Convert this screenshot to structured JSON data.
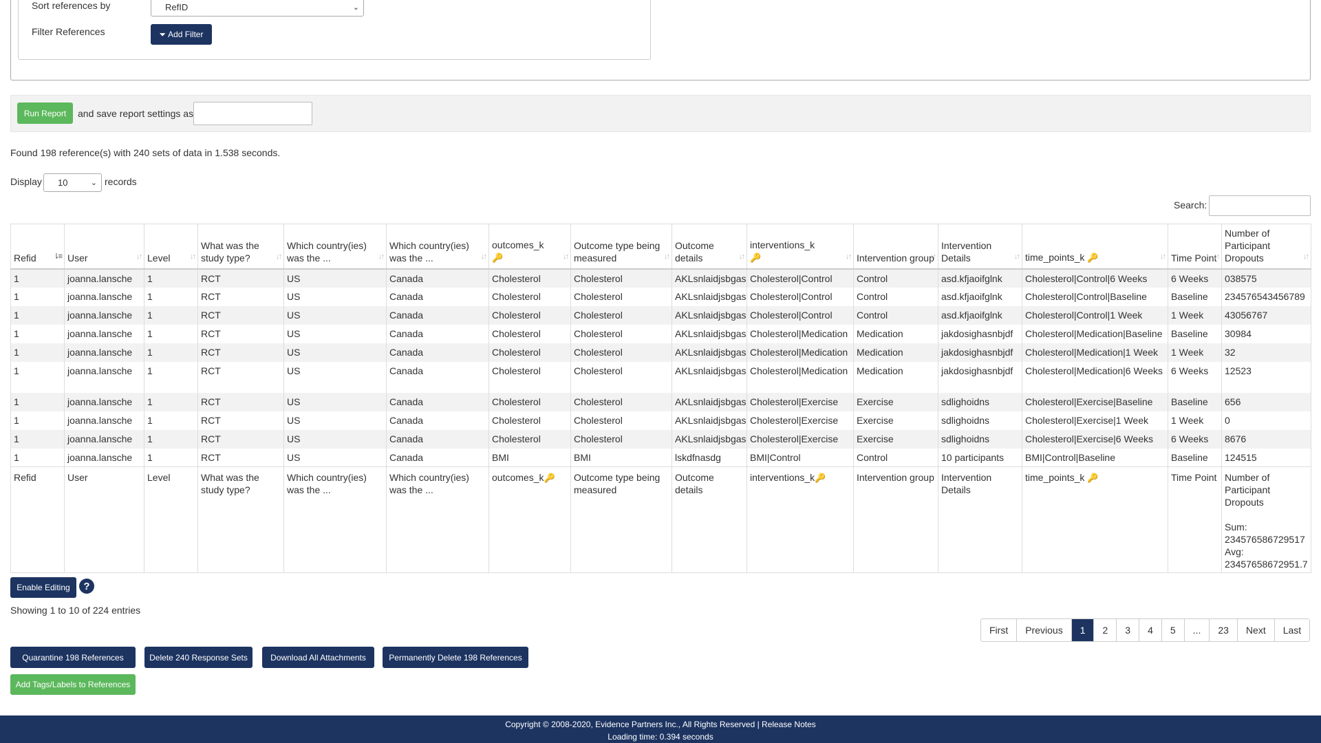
{
  "filters": {
    "sort_label": "Sort references by",
    "sort_value": "RefID",
    "filter_label": "Filter References",
    "add_filter_label": "Add Filter"
  },
  "report": {
    "run_label": "Run Report",
    "save_label": "and save report settings as",
    "save_value": ""
  },
  "summary": "Found 198 reference(s) with 240 sets of data in 1.538 seconds.",
  "display": {
    "label": "Display",
    "value": "10",
    "suffix": "records"
  },
  "search": {
    "label": "Search:",
    "value": ""
  },
  "table": {
    "headers": [
      "Refid",
      "User",
      "Level",
      "What was the study type?",
      "Which country(ies) was the ...",
      "Which country(ies) was the ...",
      "outcomes_k",
      "Outcome type being measured",
      "Outcome details",
      "interventions_k",
      "Intervention group",
      "Intervention Details",
      "time_points_k",
      "Time Point",
      "Number of Participant Dropouts"
    ],
    "rows": [
      [
        "1",
        "joanna.lansche",
        "1",
        "RCT",
        "US",
        "Canada",
        "Cholesterol",
        "Cholesterol",
        "AKLsnlaidjsbgas",
        "Cholesterol|Control",
        "Control",
        "asd.kfjaoifglnk",
        "Cholesterol|Control|6 Weeks",
        "6 Weeks",
        "038575"
      ],
      [
        "1",
        "joanna.lansche",
        "1",
        "RCT",
        "US",
        "Canada",
        "Cholesterol",
        "Cholesterol",
        "AKLsnlaidjsbgas",
        "Cholesterol|Control",
        "Control",
        "asd.kfjaoifglnk",
        "Cholesterol|Control|Baseline",
        "Baseline",
        "234576543456789"
      ],
      [
        "1",
        "joanna.lansche",
        "1",
        "RCT",
        "US",
        "Canada",
        "Cholesterol",
        "Cholesterol",
        "AKLsnlaidjsbgas",
        "Cholesterol|Control",
        "Control",
        "asd.kfjaoifglnk",
        "Cholesterol|Control|1 Week",
        "1 Week",
        "43056767"
      ],
      [
        "1",
        "joanna.lansche",
        "1",
        "RCT",
        "US",
        "Canada",
        "Cholesterol",
        "Cholesterol",
        "AKLsnlaidjsbgas",
        "Cholesterol|Medication",
        "Medication",
        "jakdosighasnbjdf",
        "Cholesterol|Medication|Baseline",
        "Baseline",
        "30984"
      ],
      [
        "1",
        "joanna.lansche",
        "1",
        "RCT",
        "US",
        "Canada",
        "Cholesterol",
        "Cholesterol",
        "AKLsnlaidjsbgas",
        "Cholesterol|Medication",
        "Medication",
        "jakdosighasnbjdf",
        "Cholesterol|Medication|1 Week",
        "1 Week",
        "32"
      ],
      [
        "1",
        "joanna.lansche",
        "1",
        "RCT",
        "US",
        "Canada",
        "Cholesterol",
        "Cholesterol",
        "AKLsnlaidjsbgas",
        "Cholesterol|Medication",
        "Medication",
        "jakdosighasnbjdf",
        "Cholesterol|Medication|6 Weeks",
        "6 Weeks",
        "12523"
      ],
      [
        "1",
        "joanna.lansche",
        "1",
        "RCT",
        "US",
        "Canada",
        "Cholesterol",
        "Cholesterol",
        "AKLsnlaidjsbgas",
        "Cholesterol|Exercise",
        "Exercise",
        "sdlighoidns",
        "Cholesterol|Exercise|Baseline",
        "Baseline",
        "656"
      ],
      [
        "1",
        "joanna.lansche",
        "1",
        "RCT",
        "US",
        "Canada",
        "Cholesterol",
        "Cholesterol",
        "AKLsnlaidjsbgas",
        "Cholesterol|Exercise",
        "Exercise",
        "sdlighoidns",
        "Cholesterol|Exercise|1 Week",
        "1 Week",
        "0"
      ],
      [
        "1",
        "joanna.lansche",
        "1",
        "RCT",
        "US",
        "Canada",
        "Cholesterol",
        "Cholesterol",
        "AKLsnlaidjsbgas",
        "Cholesterol|Exercise",
        "Exercise",
        "sdlighoidns",
        "Cholesterol|Exercise|6 Weeks",
        "6 Weeks",
        "8676"
      ],
      [
        "1",
        "joanna.lansche",
        "1",
        "RCT",
        "US",
        "Canada",
        "BMI",
        "BMI",
        "lskdfnasdg",
        "BMI|Control",
        "Control",
        "10 participants",
        "BMI|Control|Baseline",
        "Baseline",
        "124515"
      ]
    ],
    "footer": [
      "Refid",
      "User",
      "Level",
      "What was the study type?",
      "Which country(ies) was the ...",
      "Which country(ies) was the ...",
      "outcomes_k",
      "Outcome type being measured",
      "Outcome details",
      "interventions_k",
      "Intervention group",
      "Intervention Details",
      "time_points_k",
      "Time Point",
      "Number of Participant Dropouts"
    ],
    "sum_label": "Sum:",
    "sum_value": "234576586729517",
    "avg_label": "Avg:",
    "avg_value": "23457658672951.7"
  },
  "enable_editing_label": "Enable Editing",
  "help_icon": "?",
  "showing": "Showing 1 to 10 of 224 entries",
  "pagination": [
    "First",
    "Previous",
    "1",
    "2",
    "3",
    "4",
    "5",
    "...",
    "23",
    "Next",
    "Last"
  ],
  "pagination_active": "1",
  "actions": {
    "quarantine": "Quarantine 198 References",
    "delete_sets": "Delete 240 Response Sets",
    "download": "Download All Attachments",
    "perm_delete": "Permanently Delete 198 References",
    "add_tags": "Add Tags/Labels to References"
  },
  "footer": {
    "copyright": "Copyright © 2008-2020, Evidence Partners Inc., All Rights Reserved |",
    "release_notes": "Release Notes",
    "loading": "Loading time: 0.394 seconds"
  },
  "colors": {
    "navy": "#1d3461",
    "green": "#5cb85c"
  }
}
